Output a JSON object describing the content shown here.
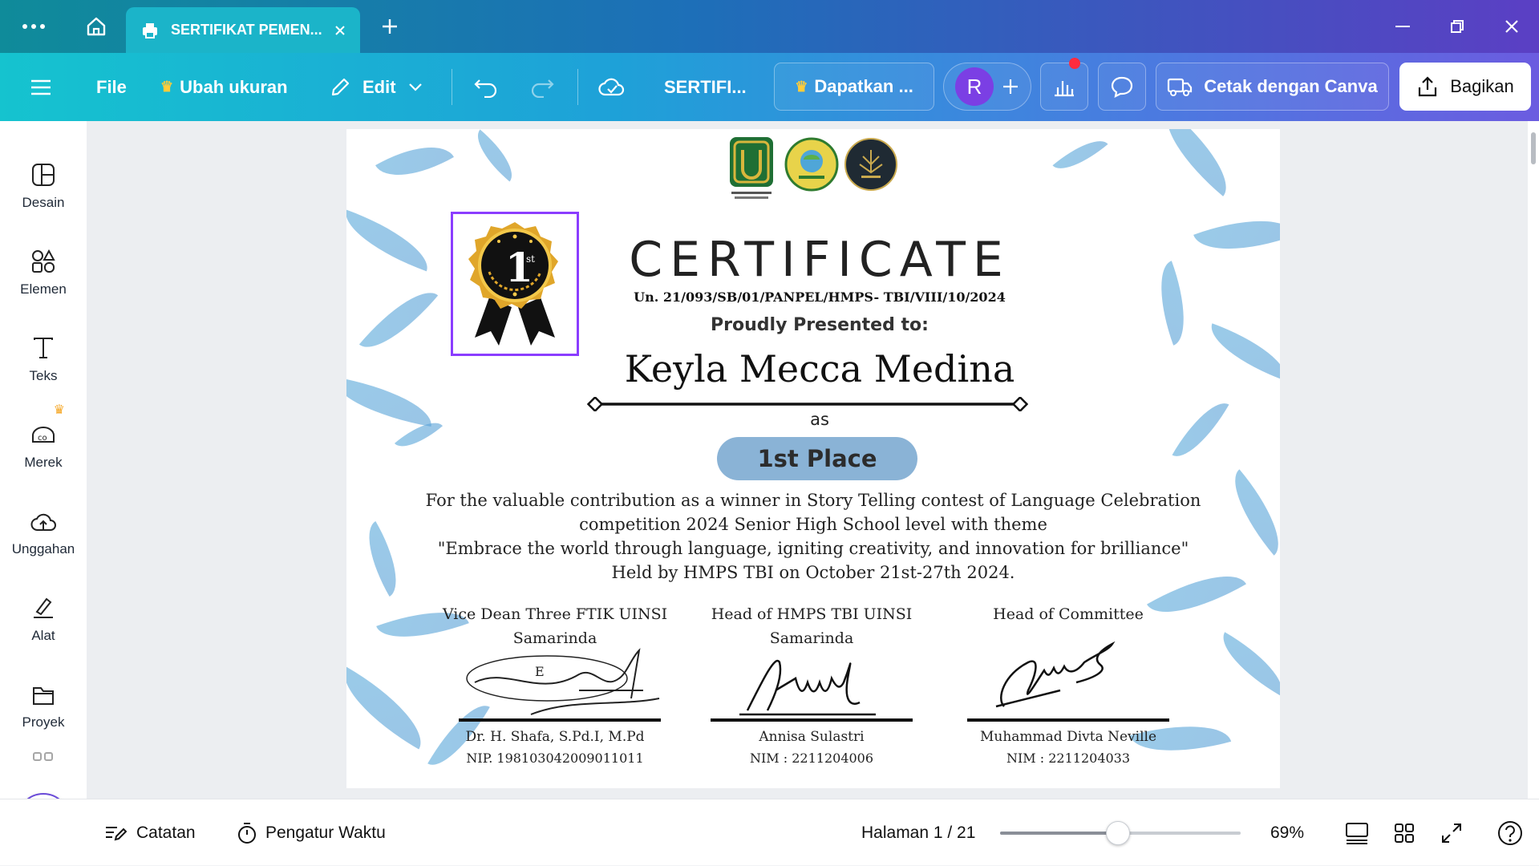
{
  "titlebar": {
    "tab_title": "SERTIFIKAT PEMEN...",
    "icons": [
      "more-icon",
      "home-icon",
      "print-icon",
      "close-icon",
      "plus-icon",
      "minimize-icon",
      "restore-icon",
      "window-close-icon"
    ]
  },
  "toolbar": {
    "file_label": "File",
    "resize_label": "Ubah ukuran",
    "edit_label": "Edit",
    "doc_title": "SERTIFI...",
    "upgrade_label": "Dapatkan ...",
    "avatar_initial": "R",
    "print_label": "Cetak dengan Canva",
    "share_label": "Bagikan"
  },
  "sidebar": {
    "items": [
      {
        "label": "Desain",
        "icon": "design-icon"
      },
      {
        "label": "Elemen",
        "icon": "elements-icon"
      },
      {
        "label": "Teks",
        "icon": "text-icon"
      },
      {
        "label": "Merek",
        "icon": "brand-icon"
      },
      {
        "label": "Unggahan",
        "icon": "upload-icon"
      },
      {
        "label": "Alat",
        "icon": "tools-icon"
      },
      {
        "label": "Proyek",
        "icon": "folder-icon"
      }
    ]
  },
  "certificate": {
    "heading": "CERTIFICATE",
    "number": "Un. 21/093/SB/01/PANPEL/HMPS- TBI/VIII/10/2024",
    "presented": "Proudly Presented to:",
    "recipient": "Keyla Mecca Medina",
    "as": "as",
    "place": "1st Place",
    "badge_text": "1",
    "badge_sup": "st",
    "body_lines": [
      "For the valuable contribution as a winner in Story Telling contest of Language Celebration",
      "competition 2024 Senior High School level with theme",
      "\"Embrace the world through language, igniting creativity, and innovation for brilliance\"",
      "Held by HMPS TBI on October 21st-27th 2024."
    ],
    "signers": [
      {
        "title1": "Vice Dean Three FTIK UINSI",
        "title2": "Samarinda",
        "name": "Dr. H. Shafa, S.Pd.I, M.Pd",
        "id": "NIP. 198103042009011011"
      },
      {
        "title1": "Head of HMPS TBI UINSI",
        "title2": "Samarinda",
        "name": "Annisa Sulastri",
        "id": "NIM : 2211204006"
      },
      {
        "title1": "Head of Committee",
        "title2": "",
        "name": "Muhammad Divta Neville",
        "id": "NIM : 2211204033"
      }
    ],
    "colors": {
      "accent_blue": "#7fb2d9",
      "place_pill": "#8ab3d6",
      "selection": "#8b3dff"
    }
  },
  "bottombar": {
    "notes_label": "Catatan",
    "timer_label": "Pengatur Waktu",
    "page_label": "Halaman 1 / 21",
    "zoom_label": "69%",
    "zoom_fraction": 0.49
  }
}
